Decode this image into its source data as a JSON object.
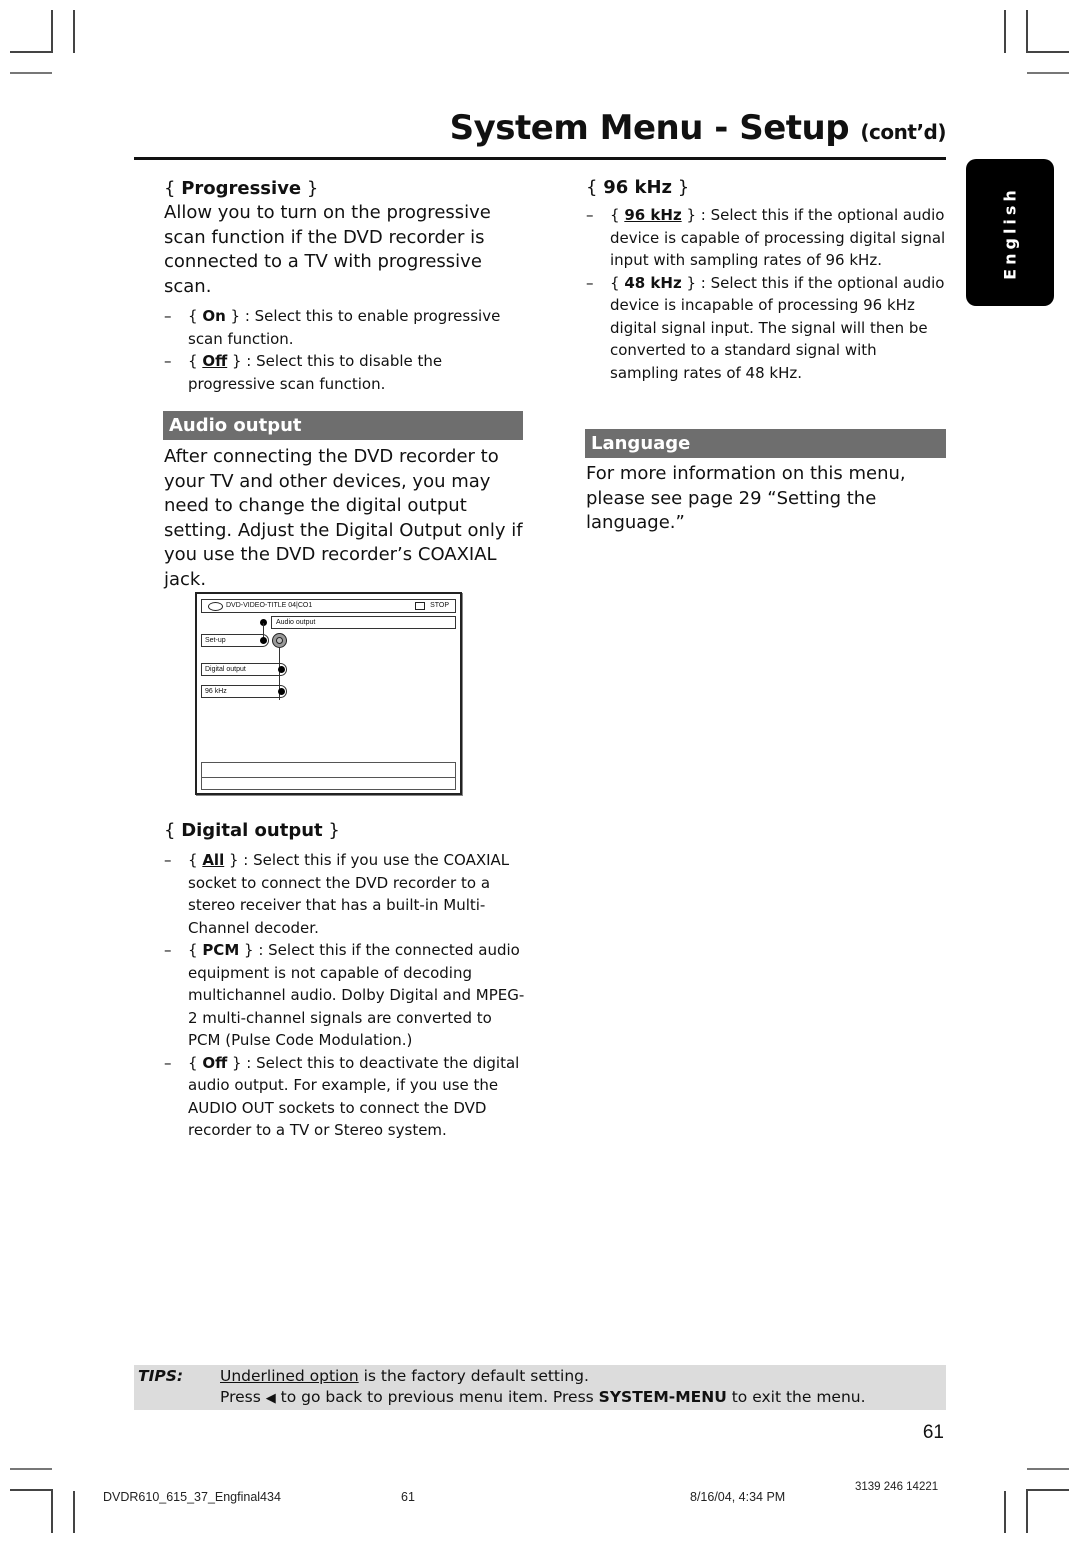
{
  "header": {
    "title": "System Menu - Setup",
    "title_suffix": "(cont’d)"
  },
  "language_tab": {
    "label": "English"
  },
  "progressive": {
    "heading_open": "{ ",
    "heading": "Progressive",
    "heading_close": " }",
    "intro": "Allow you to turn on the progressive scan function if the DVD recorder is connected to a TV with progressive scan.",
    "options": [
      {
        "dash": "–",
        "pre": "{ ",
        "label": "On",
        "post": " } : Select this to enable progressive scan function.",
        "default": false
      },
      {
        "dash": "–",
        "pre": "{ ",
        "label": "Off",
        "post": " } : Select this to disable the progressive scan function.",
        "default": true
      }
    ]
  },
  "audio_output": {
    "band": "Audio output",
    "intro": "After connecting the DVD recorder to your TV and other devices, you may need to change the digital output setting. Adjust the Digital Output only if you use the DVD recorder’s COAXIAL jack."
  },
  "menu_screen": {
    "status_title": "DVD-VIDEO-TITLE 04|CO1",
    "status_state": "STOP",
    "breadcrumb": "Audio output",
    "items": [
      "Set-up",
      "Digital output",
      "96 kHz"
    ]
  },
  "digital_output": {
    "heading_open": "{ ",
    "heading": "Digital output",
    "heading_close": " }",
    "options": [
      {
        "dash": "–",
        "pre": "{ ",
        "label": "All",
        "post": " } : Select this if you use the COAXIAL socket to connect the DVD recorder to a stereo receiver that has a built-in Multi-Channel decoder.",
        "default": true
      },
      {
        "dash": "–",
        "pre": "{ ",
        "label": "PCM",
        "post": " } : Select this if the connected audio equipment is not capable of decoding multichannel audio.  Dolby Digital and MPEG-2 multi-channel signals are converted to PCM (Pulse Code Modulation.)",
        "default": false
      },
      {
        "dash": "–",
        "pre": "{ ",
        "label": "Off",
        "post": " } : Select this to deactivate the digital audio output.  For example, if you use the AUDIO OUT sockets to connect the DVD recorder to a TV or Stereo system.",
        "default": false
      }
    ]
  },
  "khz96": {
    "heading_open": "{ ",
    "heading": "96 kHz",
    "heading_close": " }",
    "options": [
      {
        "dash": "–",
        "pre": "{ ",
        "label": "96 kHz",
        "post": " } : Select this if the optional audio device is capable of processing digital signal input with sampling rates of 96 kHz.",
        "default": true
      },
      {
        "dash": "–",
        "pre": "{ ",
        "label": "48 kHz",
        "post": " } : Select this if the optional audio device is incapable of processing 96 kHz digital signal input. The signal will then be converted to a standard signal with sampling rates of 48 kHz.",
        "default": false
      }
    ]
  },
  "language": {
    "band": "Language",
    "text": "For more information on this menu, please see page 29 “Setting the language.”"
  },
  "tips": {
    "label": "TIPS:",
    "line1_underlined": "Underlined option",
    "line1_rest": " is the factory default setting.",
    "line2_pre": "Press ",
    "line2_arrow": "◀",
    "line2_mid": " to go back to previous menu item.  Press ",
    "line2_bold": "SYSTEM-MENU",
    "line2_post": " to exit the menu."
  },
  "page_number": "61",
  "footer": {
    "file": "DVDR610_615_37_Engfinal434",
    "page": "61",
    "datetime": "8/16/04, 4:34 PM",
    "code": "3139 246 14221"
  },
  "colors": {
    "band_bg": "#6e6e6e",
    "tips_bg": "#dcdcdc",
    "tab_bg": "#000000"
  }
}
